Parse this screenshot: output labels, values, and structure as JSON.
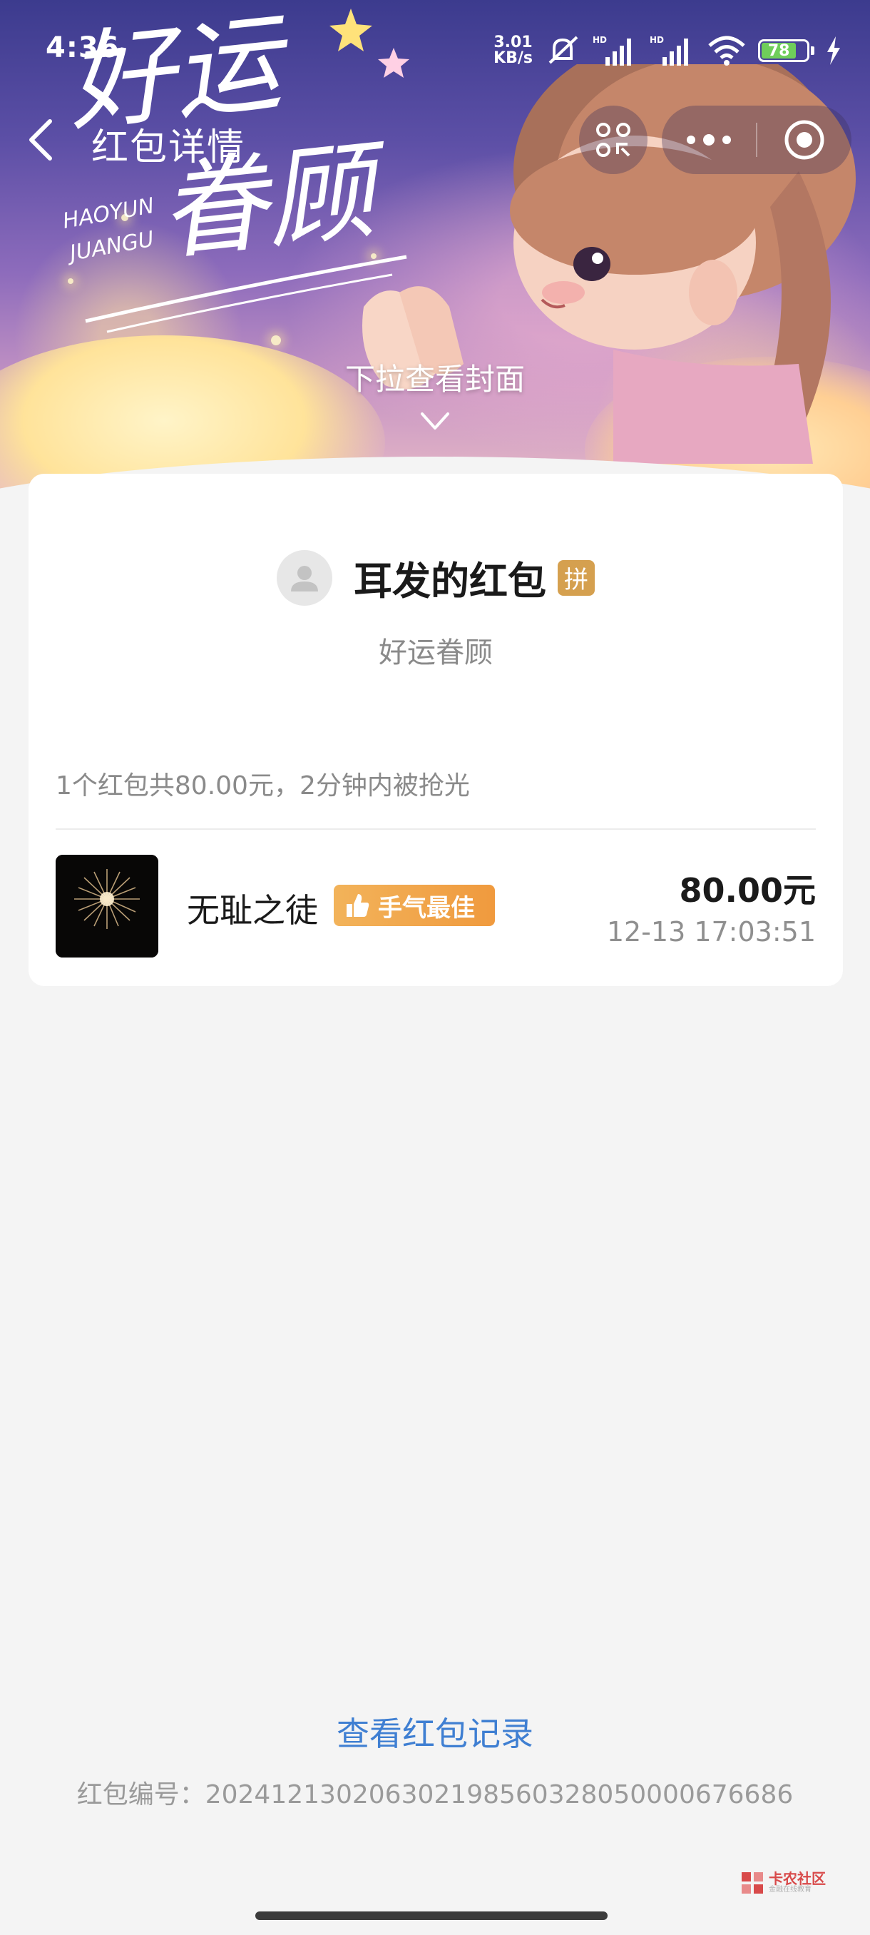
{
  "status_bar": {
    "time": "4:36",
    "speed_value": "3.01",
    "speed_unit": "KB/s",
    "battery_level": "78",
    "icons": [
      "mute-icon",
      "signal-icon",
      "signal-icon",
      "wifi-icon",
      "battery-icon",
      "charging-icon"
    ]
  },
  "nav": {
    "title": "红包详情",
    "back_icon": "chevron-left-icon",
    "scan_icon": "scan-icon",
    "more_icon": "more-dots-icon",
    "close_icon": "target-close-icon"
  },
  "cover": {
    "logo_main": "好运眷顾",
    "logo_pinyin_1": "HAOYUN",
    "logo_pinyin_2": "JUANGU",
    "pull_hint": "下拉查看封面"
  },
  "packet": {
    "sender_name": "耳发的红包",
    "badge": "拼",
    "blessing": "好运眷顾",
    "summary": "1个红包共80.00元，2分钟内被抢光"
  },
  "records": [
    {
      "name": "无耻之徒",
      "badge_label": "手气最佳",
      "amount": "80.00元",
      "time": "12-13 17:03:51"
    }
  ],
  "footer": {
    "view_records": "查看红包记录",
    "serial": "红包编号：20241213020630219856032805000067668 6",
    "watermark_title": "卡农社区",
    "watermark_sub": "金融在线教育"
  },
  "colors": {
    "accent_link": "#3f7fd2",
    "badge_gold": "#d5a04f",
    "best_badge": "#f09a3e",
    "background": "#f4f4f4"
  }
}
